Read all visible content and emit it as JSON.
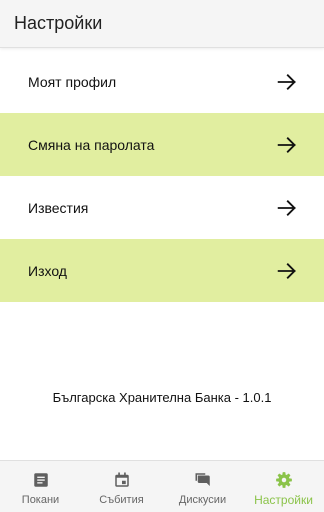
{
  "header": {
    "title": "Настройки"
  },
  "menu": {
    "items": [
      {
        "label": "Моят профил",
        "icon": "arrow-right-icon"
      },
      {
        "label": "Смяна на паролата",
        "icon": "arrow-right-icon"
      },
      {
        "label": "Известия",
        "icon": "arrow-right-icon"
      },
      {
        "label": "Изход",
        "icon": "arrow-right-icon"
      }
    ]
  },
  "footer": {
    "version_text": "Българска Хранителна Банка - 1.0.1"
  },
  "bottom_nav": {
    "items": [
      {
        "label": "Покани",
        "icon": "document-icon",
        "active": false
      },
      {
        "label": "Събития",
        "icon": "calendar-icon",
        "active": false
      },
      {
        "label": "Дискусии",
        "icon": "chat-icon",
        "active": false
      },
      {
        "label": "Настройки",
        "icon": "gear-icon",
        "active": true
      }
    ]
  },
  "colors": {
    "highlight_row": "#e1eea0",
    "active_tab": "#8bc34a",
    "inactive_icon": "#5f5f5f",
    "header_bg": "#f5f5f5"
  }
}
